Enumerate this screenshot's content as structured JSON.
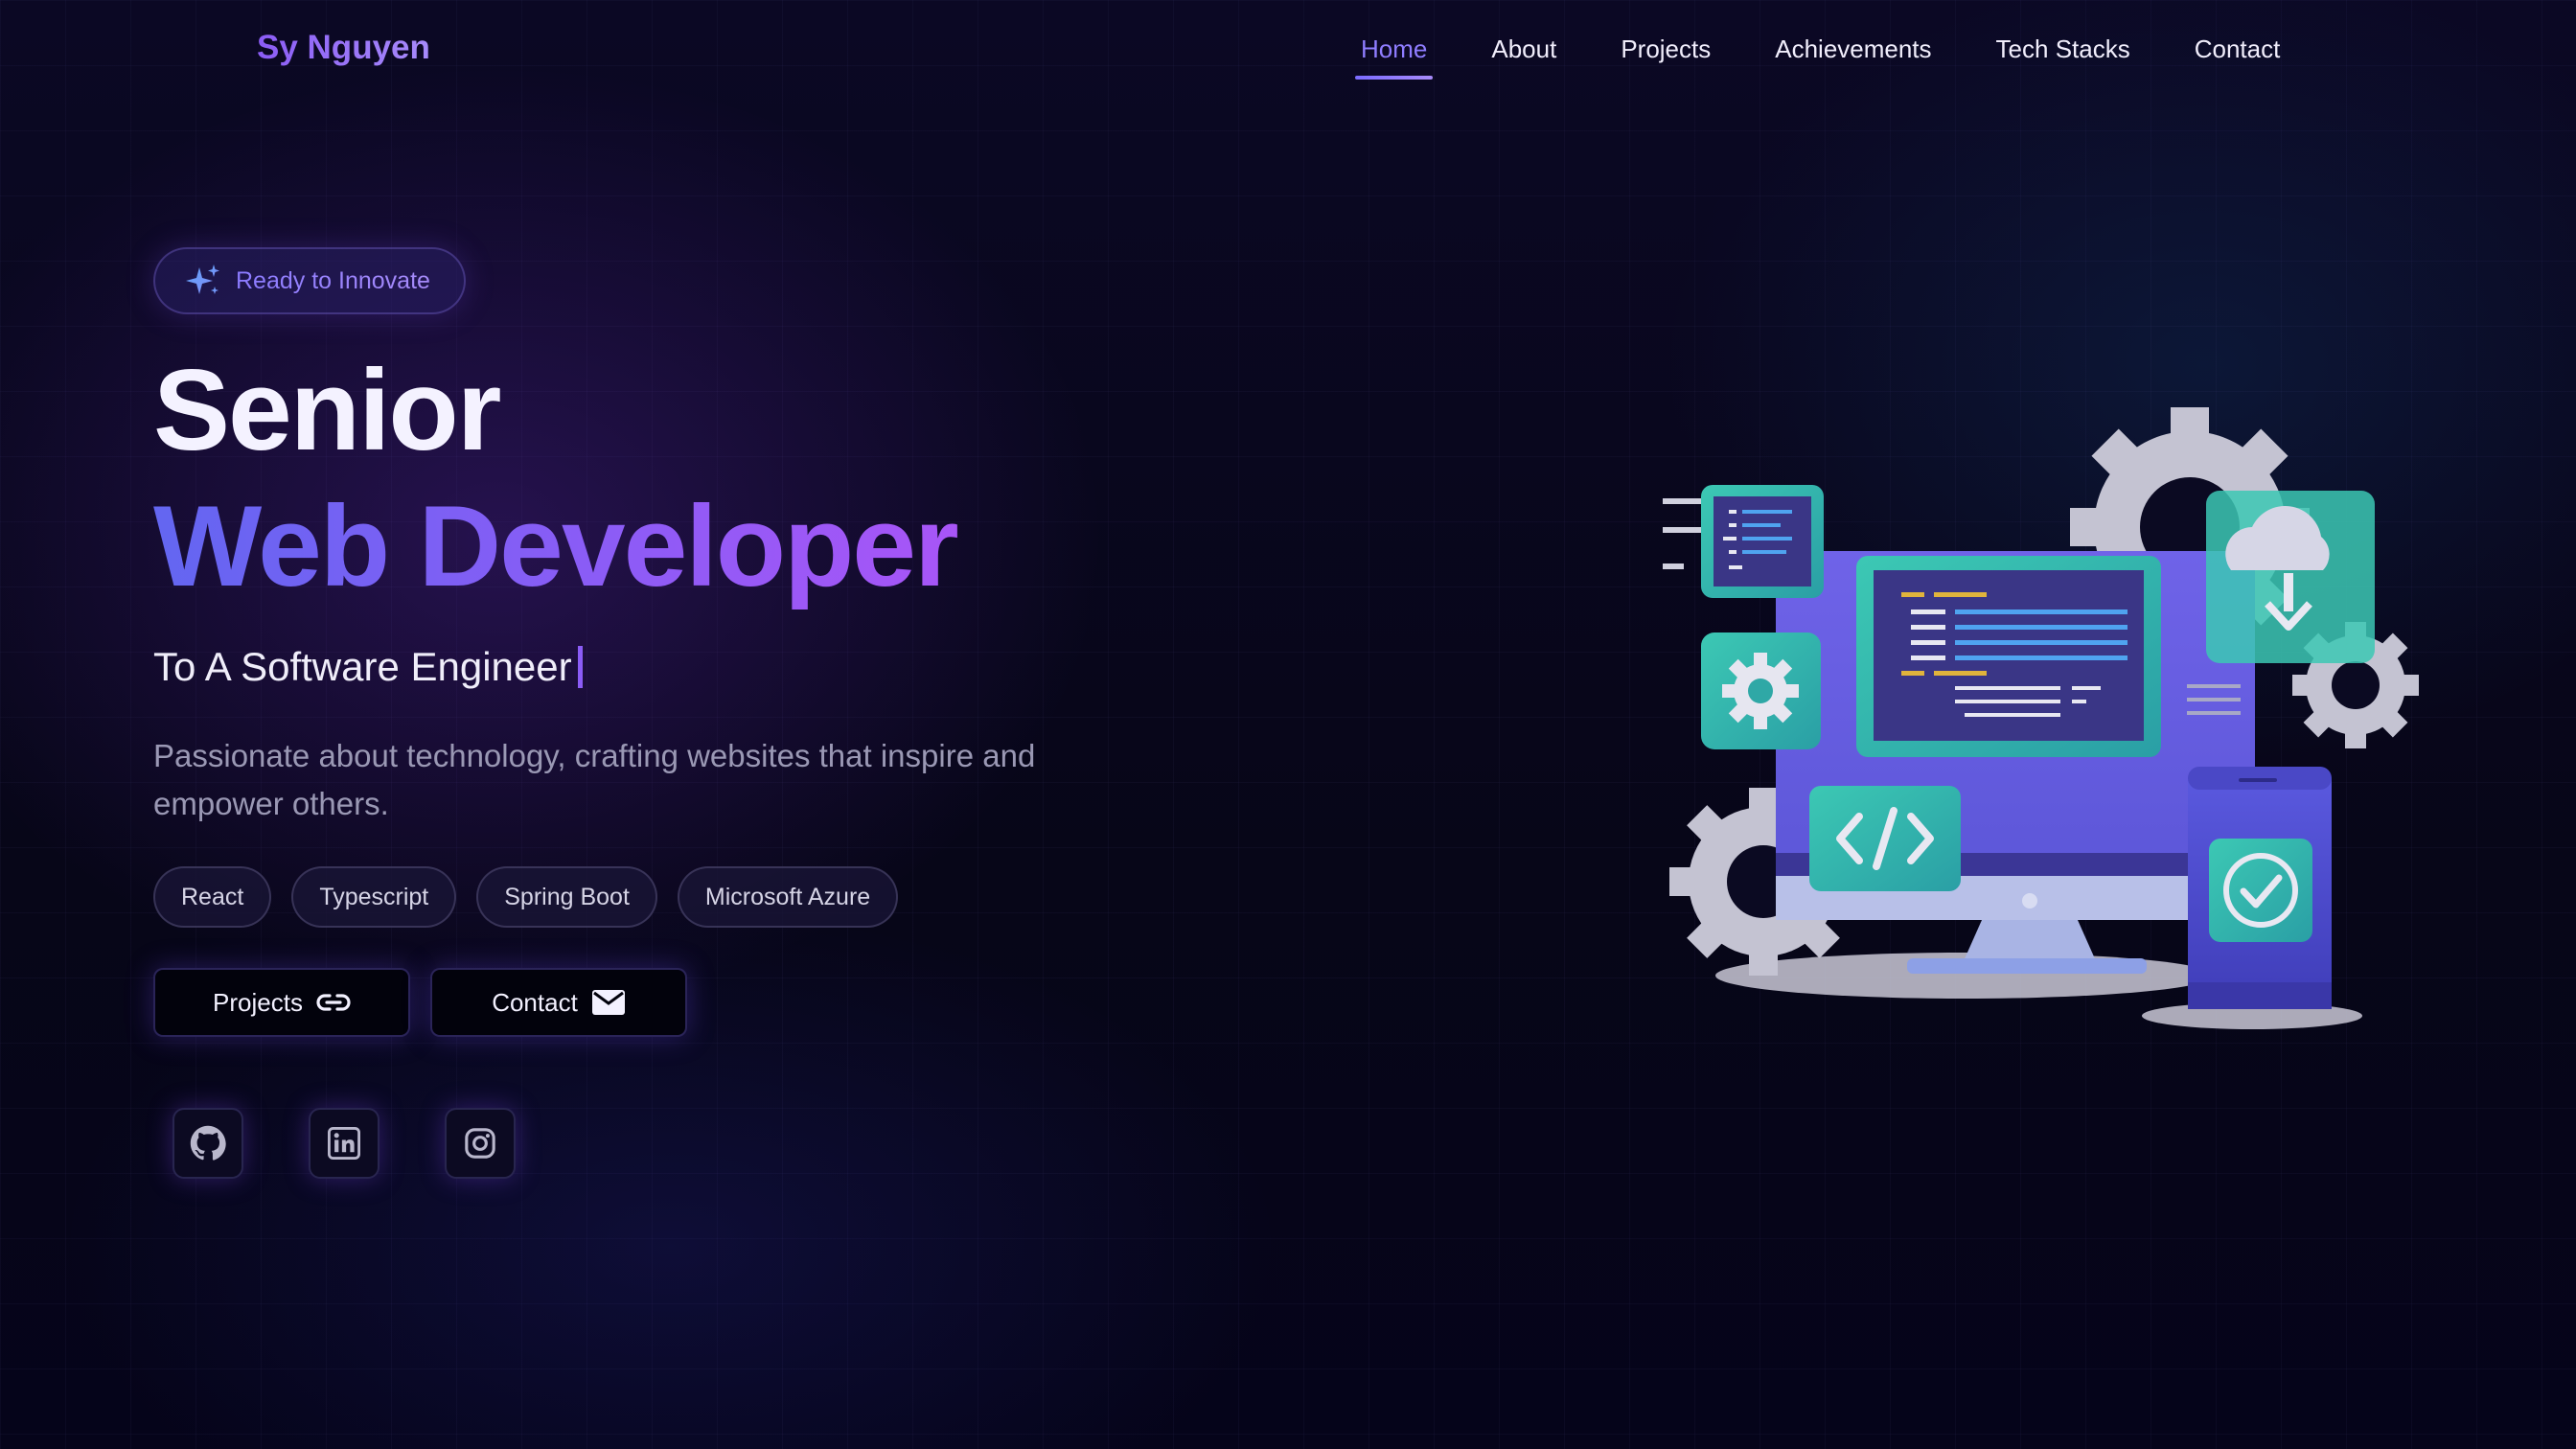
{
  "header": {
    "logo": "Sy Nguyen",
    "nav": [
      {
        "label": "Home",
        "active": true
      },
      {
        "label": "About",
        "active": false
      },
      {
        "label": "Projects",
        "active": false
      },
      {
        "label": "Achievements",
        "active": false
      },
      {
        "label": "Tech Stacks",
        "active": false
      },
      {
        "label": "Contact",
        "active": false
      }
    ]
  },
  "hero": {
    "badge": "Ready to Innovate",
    "title_line1": "Senior",
    "title_line2": "Web Developer",
    "subtitle": "To A Software Engineer",
    "description": "Passionate about technology, crafting websites that inspire and empower others.",
    "tags": [
      "React",
      "Typescript",
      "Spring Boot",
      "Microsoft Azure"
    ],
    "buttons": {
      "projects": {
        "label": "Projects",
        "icon": "link-icon"
      },
      "contact": {
        "label": "Contact",
        "icon": "mail-icon"
      }
    },
    "socials": [
      "github-icon",
      "linkedin-icon",
      "instagram-icon"
    ]
  },
  "colors": {
    "accent": "#8b5cf6",
    "accent_blue": "#6366f1",
    "teal": "#2bb8a8",
    "background": "#06051a"
  }
}
